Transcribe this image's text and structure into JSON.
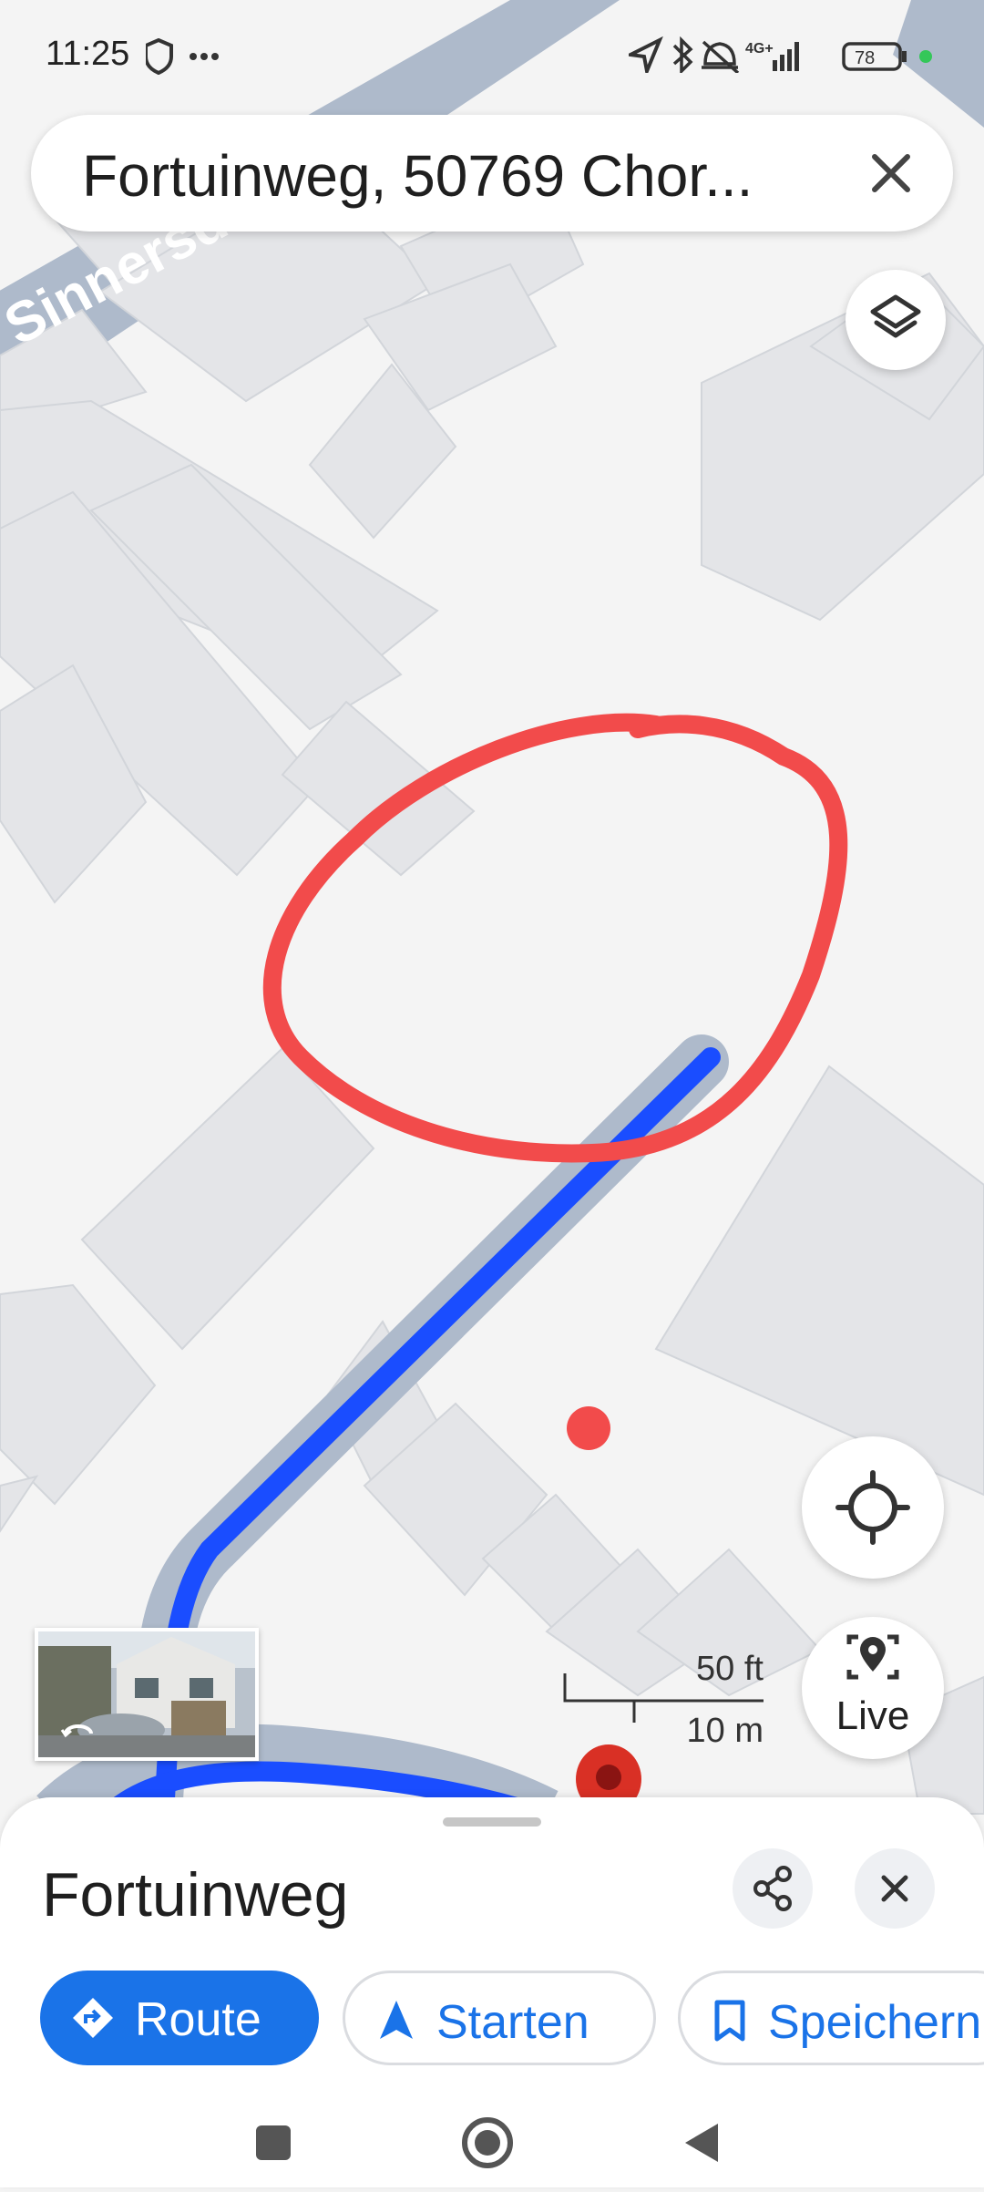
{
  "status_bar": {
    "time": "11:25",
    "network": "4G+",
    "battery": "78"
  },
  "search": {
    "value": "Fortuinweg, 50769 Chor..."
  },
  "map": {
    "street_label": "Sinnersdo",
    "scale_ft": "50 ft",
    "scale_m": "10 m",
    "route_color": "#1a4dff",
    "annotation_color": "#f24b4b"
  },
  "controls": {
    "live_label": "Live"
  },
  "place": {
    "title": "Fortuinweg",
    "actions": [
      {
        "label": "Route"
      },
      {
        "label": "Starten"
      },
      {
        "label": "Speichern"
      }
    ]
  }
}
